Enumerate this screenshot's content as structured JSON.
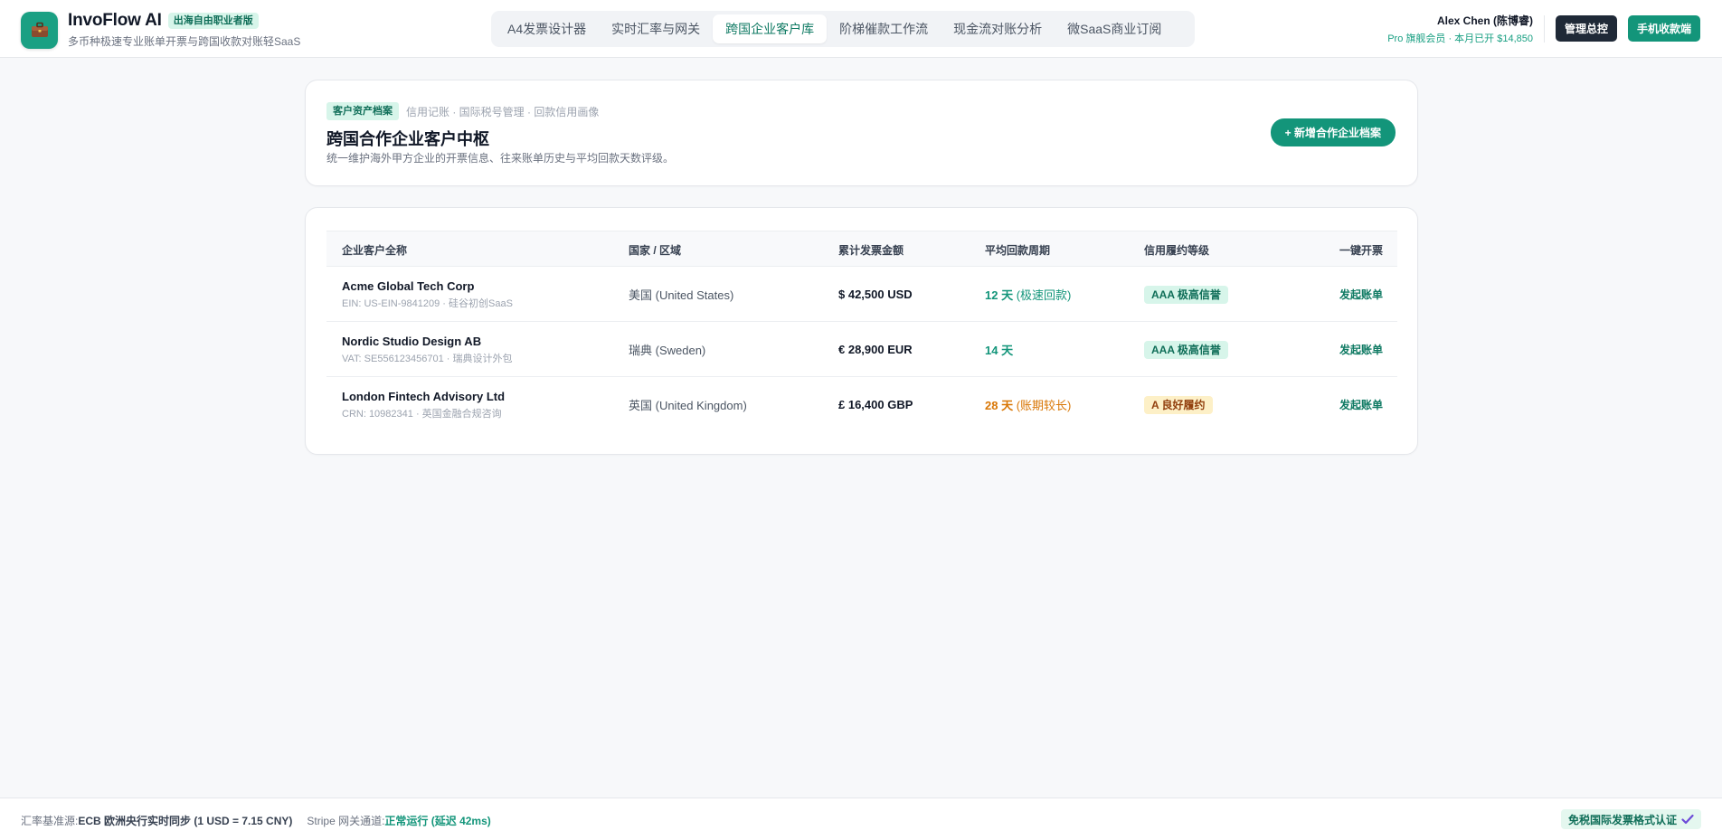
{
  "brand": {
    "name": "InvoFlow AI",
    "badge": "出海自由职业者版",
    "subtitle": "多币种极速专业账单开票与跨国收款对账轻SaaS",
    "logo_icon": "briefcase-icon"
  },
  "nav": {
    "tabs": [
      {
        "label": "A4发票设计器",
        "active": false
      },
      {
        "label": "实时汇率与网关",
        "active": false
      },
      {
        "label": "跨国企业客户库",
        "active": true
      },
      {
        "label": "阶梯催款工作流",
        "active": false
      },
      {
        "label": "现金流对账分析",
        "active": false
      },
      {
        "label": "微SaaS商业订阅",
        "active": false
      }
    ]
  },
  "user": {
    "name": "Alex Chen (陈博睿)",
    "plan": "Pro 旗舰会员 · 本月已开 $14,850"
  },
  "actions": {
    "admin_label": "管理总控",
    "mobile_label": "手机收款端"
  },
  "hero": {
    "tag": "客户资产档案",
    "tagline": "信用记账 · 国际税号管理 · 回款信用画像",
    "title": "跨国合作企业客户中枢",
    "description": "统一维护海外甲方企业的开票信息、往来账单历史与平均回款天数评级。",
    "add_button": "+ 新增合作企业档案"
  },
  "table": {
    "headers": {
      "name": "企业客户全称",
      "country": "国家 / 区域",
      "amount": "累计发票金额",
      "cycle": "平均回款周期",
      "grade": "信用履约等级",
      "action": "一键开票"
    },
    "rows": [
      {
        "name": "Acme Global Tech Corp",
        "id": "EIN: US-EIN-9841209 · 硅谷初创SaaS",
        "country": "美国 (United States)",
        "amount": "$ 42,500 USD",
        "cycle": "12 天",
        "cycle_note": " (极速回款)",
        "cycle_color": "#13957a",
        "grade": "AAA 极高信誉",
        "grade_bg": "#d7f5ea",
        "grade_color": "#0f6e58",
        "action": "发起账单"
      },
      {
        "name": "Nordic Studio Design AB",
        "id": "VAT: SE556123456701 · 瑞典设计外包",
        "country": "瑞典 (Sweden)",
        "amount": "€ 28,900 EUR",
        "cycle": "14 天",
        "cycle_note": "",
        "cycle_color": "#13957a",
        "grade": "AAA 极高信誉",
        "grade_bg": "#d7f5ea",
        "grade_color": "#0f6e58",
        "action": "发起账单"
      },
      {
        "name": "London Fintech Advisory Ltd",
        "id": "CRN: 10982341 · 英国金融合规咨询",
        "country": "英国 (United Kingdom)",
        "amount": "£ 16,400 GBP",
        "cycle": "28 天",
        "cycle_note": " (账期较长)",
        "cycle_color": "#d97706",
        "grade": "A 良好履约",
        "grade_bg": "#fdf0c7",
        "grade_color": "#92400e",
        "action": "发起账单"
      }
    ]
  },
  "footer": {
    "rate_label": "汇率基准源: ",
    "rate_value": "ECB 欧洲央行实时同步 (1 USD = 7.15 CNY)",
    "gateway_label": "Stripe 网关通道: ",
    "gateway_value": "正常运行 (延迟 42ms)",
    "cert_badge": "免税国际发票格式认证",
    "cert_icon": "check-icon"
  },
  "colors": {
    "accent": "#13957a",
    "dark": "#1f2937"
  }
}
